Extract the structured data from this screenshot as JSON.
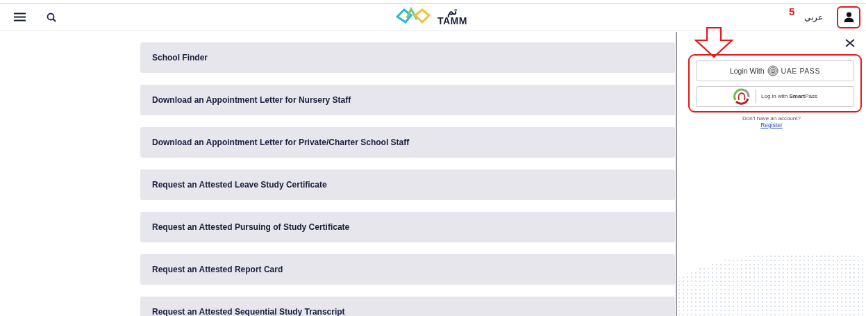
{
  "header": {
    "logo_arabic": "تم",
    "logo_text": "TAMM",
    "language_link": "عربي"
  },
  "annotation": {
    "step_number": "5"
  },
  "services": [
    {
      "title": "School Finder"
    },
    {
      "title": "Download an Appointment Letter for Nursery Staff"
    },
    {
      "title": "Download an Appointment Letter for Private/Charter School Staff"
    },
    {
      "title": "Request an Attested Leave Study Certificate"
    },
    {
      "title": "Request an Attested Pursuing of Study Certificate"
    },
    {
      "title": "Request an Attested Report Card"
    },
    {
      "title": "Request an Attested Sequential Study Transcript"
    }
  ],
  "login_panel": {
    "buttons": [
      {
        "kind": "uaepass",
        "label": "Login With",
        "brand": "UAE PASS"
      },
      {
        "kind": "smartpass",
        "label": "Log in with **Smart**Pass"
      }
    ],
    "no_account_text": "Don't have an account?",
    "register_link": "Register"
  }
}
